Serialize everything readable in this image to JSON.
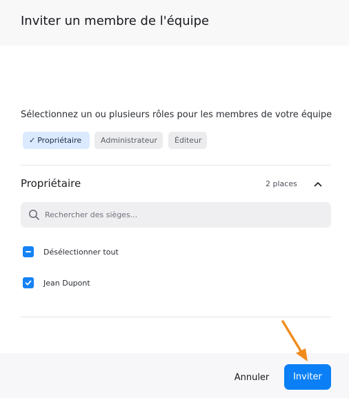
{
  "dialog": {
    "title": "Inviter un membre de l'équipe"
  },
  "roles": {
    "prompt": "Sélectionnez un ou plusieurs rôles pour les membres de votre équipe",
    "chips": [
      {
        "label": "Propriétaire",
        "selected": true
      },
      {
        "label": "Administrateur",
        "selected": false
      },
      {
        "label": "Éditeur",
        "selected": false
      }
    ],
    "check_icon": "check-icon"
  },
  "section": {
    "title": "Propriétaire",
    "places": "2 places",
    "collapse_icon": "chevron-up-icon"
  },
  "search": {
    "placeholder": "Rechercher des sièges...",
    "value": "",
    "icon": "search-icon"
  },
  "members": [
    {
      "label": "Désélectionner tout",
      "state": "indeterminate"
    },
    {
      "label": "Jean Dupont",
      "state": "checked"
    }
  ],
  "footer": {
    "cancel_label": "Annuler",
    "invite_label": "Inviter"
  },
  "colors": {
    "accent": "#0b7ff5",
    "selected_chip_bg": "#dbeafe",
    "annotation_arrow": "#f08c1e"
  }
}
